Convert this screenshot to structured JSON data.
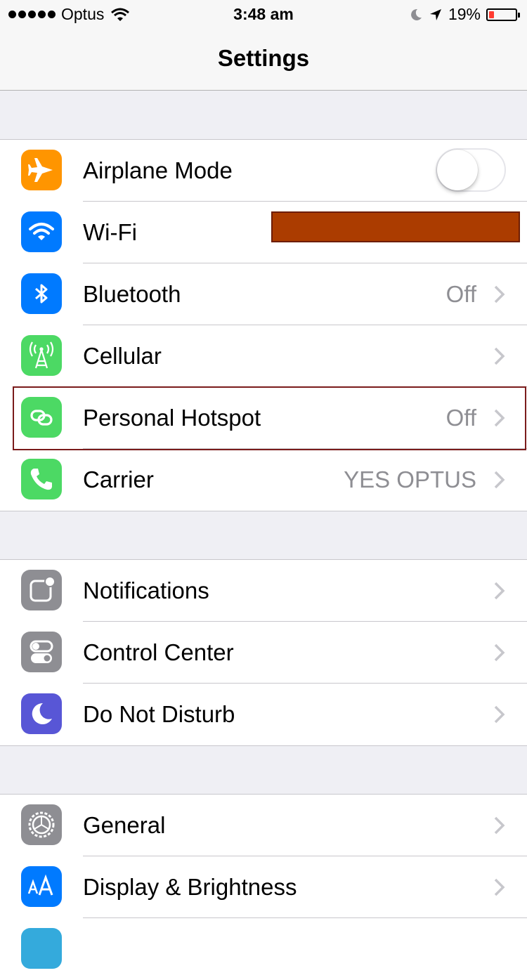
{
  "status_bar": {
    "carrier": "Optus",
    "time": "3:48 am",
    "battery_percent": "19%",
    "battery_level": 0.19,
    "battery_color": "#ff3b30"
  },
  "nav": {
    "title": "Settings"
  },
  "groups": [
    {
      "rows": [
        {
          "label": "Airplane Mode",
          "icon": "airplane-icon",
          "icon_color": "#ff9500",
          "control": "toggle",
          "toggle_on": false
        },
        {
          "label": "Wi-Fi",
          "icon": "wifi-icon",
          "icon_color": "#007aff",
          "value": "",
          "redacted": true
        },
        {
          "label": "Bluetooth",
          "icon": "bluetooth-icon",
          "icon_color": "#007aff",
          "value": "Off"
        },
        {
          "label": "Cellular",
          "icon": "cellular-icon",
          "icon_color": "#4cd964",
          "value": ""
        },
        {
          "label": "Personal Hotspot",
          "icon": "hotspot-icon",
          "icon_color": "#4cd964",
          "value": "Off",
          "highlighted": true
        },
        {
          "label": "Carrier",
          "icon": "phone-icon",
          "icon_color": "#4cd964",
          "value": "YES OPTUS"
        }
      ]
    },
    {
      "rows": [
        {
          "label": "Notifications",
          "icon": "notifications-icon",
          "icon_color": "#8e8e93"
        },
        {
          "label": "Control Center",
          "icon": "control-center-icon",
          "icon_color": "#8e8e93"
        },
        {
          "label": "Do Not Disturb",
          "icon": "moon-icon",
          "icon_color": "#5856d6"
        }
      ]
    },
    {
      "rows": [
        {
          "label": "General",
          "icon": "gear-icon",
          "icon_color": "#8e8e93"
        },
        {
          "label": "Display & Brightness",
          "icon": "text-size-icon",
          "icon_color": "#007aff"
        }
      ]
    }
  ]
}
